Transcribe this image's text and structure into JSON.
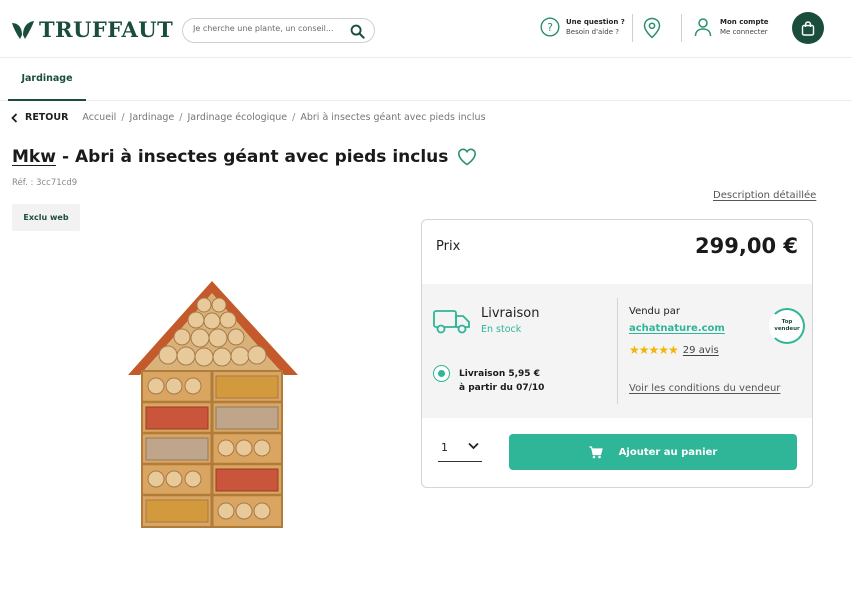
{
  "header": {
    "logo_text": "TRUFFAUT",
    "search_placeholder": "Je cherche une plante, un conseil...",
    "help_title": "Une question ?",
    "help_subtitle": "Besoin d'aide ?",
    "account_title": "Mon compte",
    "account_subtitle": "Me connecter"
  },
  "nav": {
    "tabs": [
      {
        "label": "Jardinage",
        "active": true
      }
    ]
  },
  "breadcrumb": {
    "back_label": "RETOUR",
    "items": [
      "Accueil",
      "Jardinage",
      "Jardinage écologique",
      "Abri à insectes géant avec pieds inclus"
    ]
  },
  "product": {
    "brand": "Mkw",
    "separator": "-",
    "name": "Abri à insectes géant avec pieds inclus",
    "ref": "Réf. : 3cc71cd9",
    "badge": "Exclu web",
    "description_link": "Description détaillée"
  },
  "buybox": {
    "price_label": "Prix",
    "price": "299,00 €",
    "delivery_title": "Livraison",
    "delivery_stock": "En stock",
    "delivery_option_line1": "Livraison 5,95 €",
    "delivery_option_line2": "à partir du 07/10",
    "sold_by_label": "Vendu par",
    "seller_name": "achatnature.com",
    "rating_stars": 5,
    "reviews": "29 avis",
    "seller_conditions": "Voir les conditions du vendeur",
    "top_seller_line1": "Top",
    "top_seller_line2": "vendeur",
    "quantity": "1",
    "add_to_cart": "Ajouter au panier"
  },
  "colors": {
    "brand_green": "#1a4d3c",
    "accent_teal": "#2fb597",
    "star": "#f2b705"
  }
}
